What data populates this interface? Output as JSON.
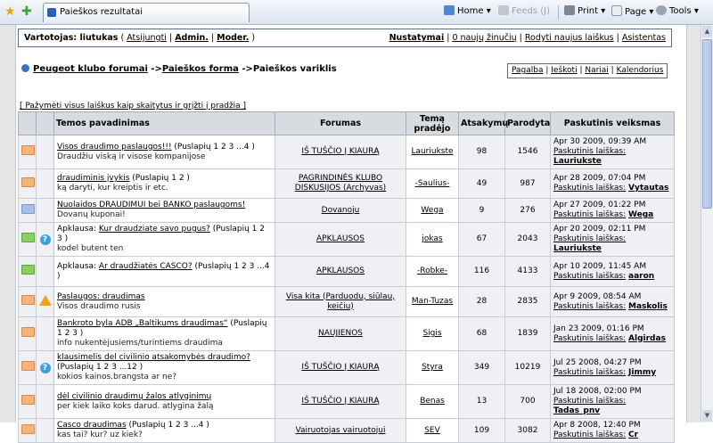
{
  "browser": {
    "tab_title": "Paieškos rezultatai",
    "toolbar": {
      "home": "Home",
      "feeds": "Feeds (J)",
      "print": "Print",
      "page": "Page",
      "tools": "Tools"
    }
  },
  "userbar": {
    "prefix": "Vartotojas:",
    "username": "liutukas",
    "logout": "Atsijungti",
    "admin": "Admin.",
    "moder": "Moder.",
    "settings": "Nustatymai",
    "new_msgs": "0 naujų žinučių",
    "show_new": "Rodyti naujus laiškus",
    "assistant": "Asistentas"
  },
  "breadcrumb": {
    "part1": "Peugeot klubo forumai",
    "arrow1": " ->",
    "part2": "Paieškos forma",
    "arrow2": " ->",
    "part3": "Paieškos variklis"
  },
  "nav": {
    "help": "Pagalba",
    "search": "Ieškoti",
    "members": "Nariai",
    "calendar": "Kalendorius"
  },
  "mark_all": "[ Pažymėti visus laiškus kaip skaitytus ir grįžti į pradžia ]",
  "table": {
    "headers": [
      "Temos pavadinimas",
      "Forumas",
      "Temą pradėjo",
      "Atsakymų",
      "Parodyta",
      "Paskutinis veiksmas"
    ],
    "last_label": "Paskutinis laiškas:",
    "rows": [
      {
        "env": "or",
        "icon": "",
        "prefix": "",
        "title": "Visos draudimo paslaugos!!!",
        "pages": " (Puslapių 1 2 3 ...4 )",
        "desc": "Draudžiu viską ir visose kompanijose",
        "forum": "IŠ TUŠČIO Į KIAURĄ",
        "author": "Lauriukste",
        "replies": "98",
        "views": "1546",
        "date": "Apr 30 2009, 09:39 AM",
        "last": "Lauriukste"
      },
      {
        "env": "or",
        "icon": "",
        "prefix": "",
        "title": "draudiminis įvykis",
        "pages": " (Puslapių 1 2 )",
        "desc": "ką daryti, kur kreiptis ir etc.",
        "forum": "PAGRINDINĖS KLUBO DISKUSIJOS (Archyvas)",
        "author": "-Saulius-",
        "replies": "49",
        "views": "987",
        "date": "Apr 28 2009, 07:04 PM",
        "last": "Vytautas"
      },
      {
        "env": "bl",
        "icon": "",
        "prefix": "",
        "title": "Nuolaidos DRAUDIMUI bei BANKO paslaugoms!",
        "pages": "",
        "desc": "Dovanų kuponai!",
        "forum": "Dovanoju",
        "author": "Wega",
        "replies": "9",
        "views": "276",
        "date": "Apr 27 2009, 01:22 PM",
        "last": "Wega"
      },
      {
        "env": "gr",
        "icon": "q",
        "prefix": "Apklausa: ",
        "title": "Kur draudziate savo pugus?",
        "pages": " (Puslapių 1 2 3 )",
        "desc": "kodel butent ten",
        "forum": "APKLAUSOS",
        "author": "jokas",
        "replies": "67",
        "views": "2043",
        "date": "Apr 20 2009, 02:11 PM",
        "last": "Lauriukste"
      },
      {
        "env": "gr",
        "icon": "",
        "prefix": "Apklausa: ",
        "title": "Ar draudžiatės CASCO?",
        "pages": " (Puslapių 1 2 3 ...4 )",
        "desc": "",
        "forum": "APKLAUSOS",
        "author": "-Robke-",
        "replies": "116",
        "views": "4133",
        "date": "Apr 10 2009, 11:45 AM",
        "last": "aaron"
      },
      {
        "env": "or",
        "icon": "w",
        "prefix": "",
        "title": "Paslaugos: draudimas",
        "pages": "",
        "desc": "Visos draudimo rusis",
        "forum": "Visa kita (Parduodu, siūlau, keičiu)",
        "author": "Man-Tuzas",
        "replies": "28",
        "views": "2835",
        "date": "Apr 9 2009, 08:54 AM",
        "last": "Maskolis"
      },
      {
        "env": "or",
        "icon": "",
        "prefix": "",
        "title": "Bankroto byla ADB „Baltikums draudimas“",
        "pages": " (Puslapių 1 2 3 )",
        "desc": "info nukentėjusiems/turintiems draudima",
        "forum": "NAUJIENOS",
        "author": "Sigis",
        "replies": "68",
        "views": "1839",
        "date": "Jan 23 2009, 01:16 PM",
        "last": "Algirdas"
      },
      {
        "env": "or",
        "icon": "q",
        "prefix": "",
        "title": "klausimelis del civilinio atsakomybės draudimo?",
        "pages": " (Puslapių 1 2 3 ...12 )",
        "desc": "kokios kainos.brangsta ar ne?",
        "forum": "IŠ TUŠČIO Į KIAURĄ",
        "author": "Styra",
        "replies": "349",
        "views": "10219",
        "date": "Jul 25 2008, 04:27 PM",
        "last": "Jimmy"
      },
      {
        "env": "or",
        "icon": "",
        "prefix": "",
        "title": "dėl civilinio draudimų žalos atlyginimų",
        "pages": "",
        "desc": "per kiek laiko koks darud. atlygina žalą",
        "forum": "IŠ TUŠČIO Į KIAURĄ",
        "author": "Benas",
        "replies": "13",
        "views": "700",
        "date": "Jul 18 2008, 02:00 PM",
        "last": "Tadas_pnv"
      },
      {
        "env": "or",
        "icon": "",
        "prefix": "",
        "title": "Casco draudimas",
        "pages": " (Puslapių 1 2 3 ...4 )",
        "desc": "kas tai? kur? uz kiek?",
        "forum": "Vairuotojas vairuotojui",
        "author": "SEV",
        "replies": "109",
        "views": "3082",
        "date": "Apr 8 2008, 12:40 PM",
        "last": "Cr"
      }
    ]
  }
}
